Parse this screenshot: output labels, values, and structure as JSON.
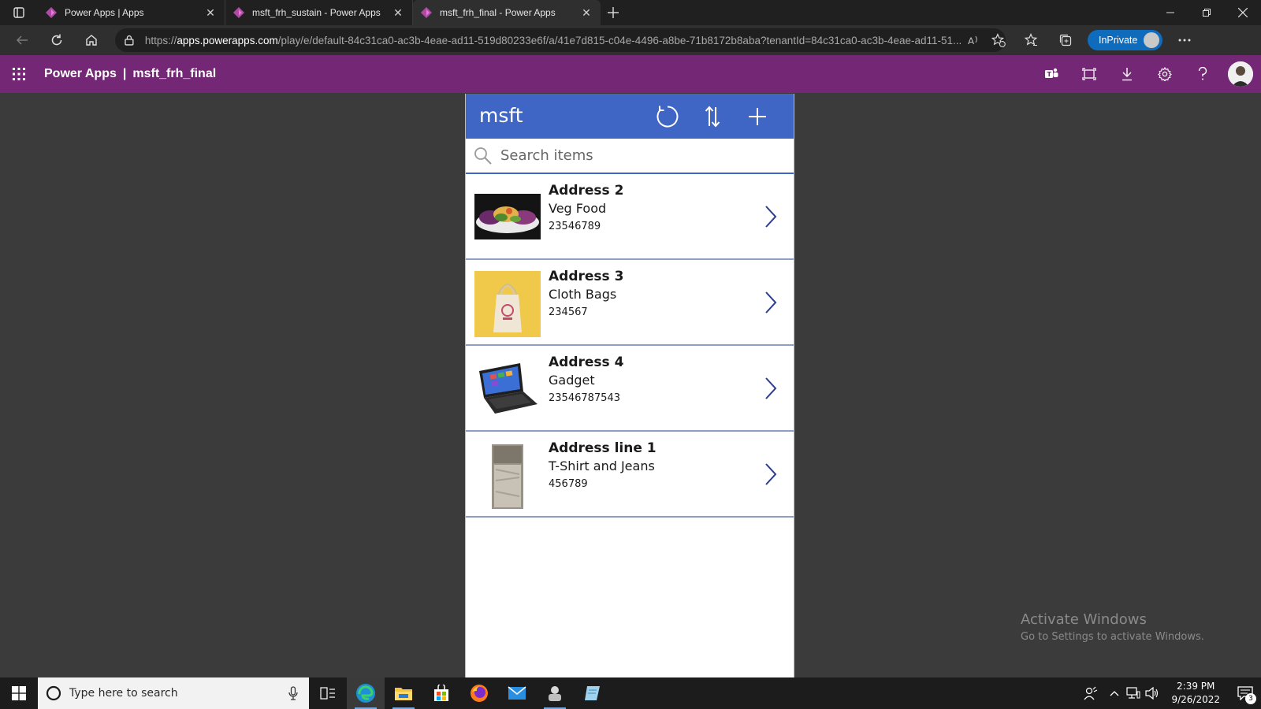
{
  "browser": {
    "tabs": [
      {
        "title": "Power Apps | Apps",
        "icon": "power-apps-icon",
        "active": false
      },
      {
        "title": "msft_frh_sustain - Power Apps",
        "icon": "power-apps-icon",
        "active": false
      },
      {
        "title": "msft_frh_final - Power Apps",
        "icon": "power-apps-icon",
        "active": true
      }
    ],
    "url_prefix": "https://",
    "url_host": "apps.powerapps.com",
    "url_rest": "/play/e/default-84c31ca0-ac3b-4eae-ad11-519d80233e6f/a/41e7d815-c04e-4496-a8be-71b8172b8aba?tenantId=84c31ca0-ac3b-4eae-ad11-51...",
    "inprivate_label": "InPrivate"
  },
  "powerapps": {
    "brand": "Power Apps",
    "separator": "|",
    "app_name": "msft_frh_final",
    "header_color": "#742774"
  },
  "app": {
    "title": "msft",
    "accent": "#3f66c4",
    "search_placeholder": "Search items",
    "items": [
      {
        "title": "Address 2",
        "subtitle": "Veg Food",
        "number": "23546789",
        "thumb": "food"
      },
      {
        "title": "Address 3",
        "subtitle": "Cloth Bags",
        "number": "234567",
        "thumb": "bag"
      },
      {
        "title": "Address 4",
        "subtitle": "Gadget",
        "number": "23546787543",
        "thumb": "laptop"
      },
      {
        "title": "Address line 1",
        "subtitle": "T-Shirt and Jeans",
        "number": "456789",
        "thumb": "clothes"
      }
    ]
  },
  "watermark": {
    "line1": "Activate Windows",
    "line2": "Go to Settings to activate Windows."
  },
  "taskbar": {
    "search_placeholder": "Type here to search",
    "time": "2:39 PM",
    "date": "9/26/2022",
    "notification_count": "3"
  }
}
